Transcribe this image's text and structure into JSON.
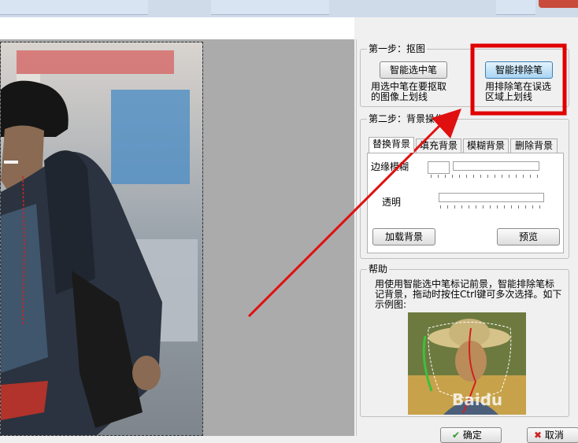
{
  "step1": {
    "title": "第一步：抠图",
    "smart_select_label": "智能选中笔",
    "smart_exclude_label": "智能排除笔",
    "select_desc_1": "用选中笔在要抠取",
    "select_desc_2": "的图像上划线",
    "exclude_desc_1": "用排除笔在误选",
    "exclude_desc_2": "区域上划线"
  },
  "step2": {
    "title": "第二步：背景操作",
    "tabs": [
      "替换背景",
      "填充背景",
      "模糊背景",
      "删除背景"
    ],
    "edge_blur_label": "边缘模糊",
    "transparent_label": "透明",
    "load_bg_label": "加载背景",
    "preview_label": "预览"
  },
  "help": {
    "title": "帮助",
    "text": "用使用智能选中笔标记前景，智能排除笔标记背景，拖动时按住Ctrl键可多次选择。如下示例图:",
    "watermark": "Baidu"
  },
  "footer": {
    "ok_label": "确定",
    "cancel_label": "取消"
  },
  "colors": {
    "highlight_box": "#e00000",
    "arrow": "#e01010",
    "active_button": "#a9d5f3"
  }
}
